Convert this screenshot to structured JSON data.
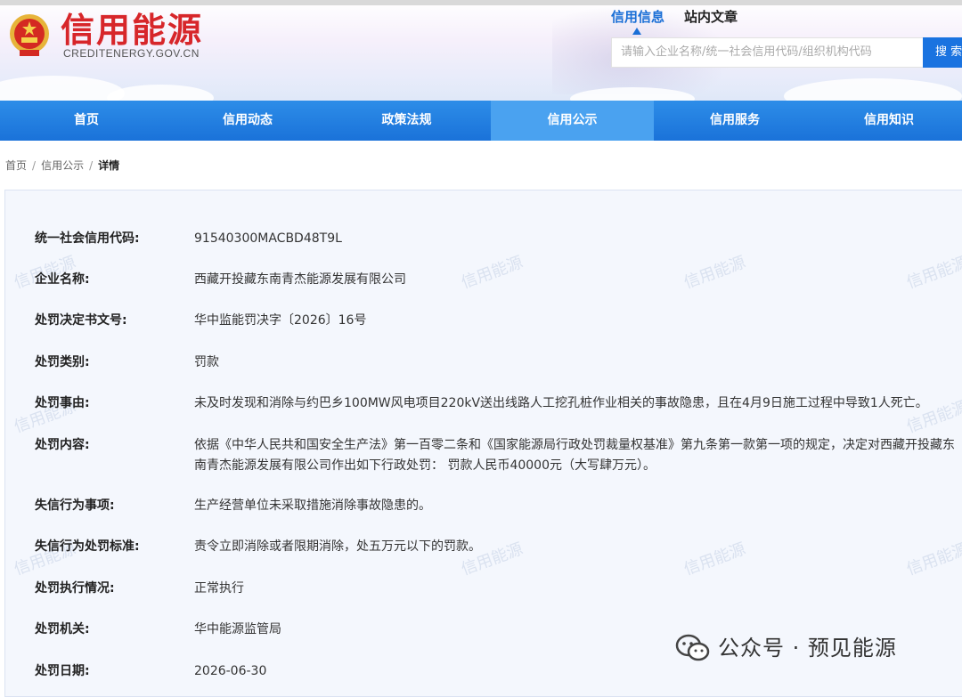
{
  "header": {
    "title": "信用能源",
    "subtitle": "CREDITENERGY.GOV.CN",
    "search_tabs": [
      {
        "label": "信用信息",
        "active": true
      },
      {
        "label": "站内文章",
        "active": false
      }
    ],
    "search_placeholder": "请输入企业名称/统一社会信用代码/组织机构代码",
    "search_button": "搜 索"
  },
  "nav": {
    "items": [
      {
        "label": "首页",
        "active": false
      },
      {
        "label": "信用动态",
        "active": false
      },
      {
        "label": "政策法规",
        "active": false
      },
      {
        "label": "信用公示",
        "active": true
      },
      {
        "label": "信用服务",
        "active": false
      },
      {
        "label": "信用知识",
        "active": false
      }
    ]
  },
  "breadcrumb": {
    "items": [
      "首页",
      "信用公示"
    ],
    "current": "详情",
    "separator": "/"
  },
  "watermark_text": "信用能源",
  "detail": {
    "rows": [
      {
        "label": "统一社会信用代码:",
        "value": "91540300MACBD48T9L"
      },
      {
        "label": "企业名称:",
        "value": "西藏开投藏东南青杰能源发展有限公司"
      },
      {
        "label": "处罚决定书文号:",
        "value": "华中监能罚决字〔2026〕16号"
      },
      {
        "label": "处罚类别:",
        "value": "罚款"
      },
      {
        "label": "处罚事由:",
        "value": "未及时发现和消除与约巴乡100MW风电项目220kV送出线路人工挖孔桩作业相关的事故隐患，且在4月9日施工过程中导致1人死亡。"
      },
      {
        "label": "处罚内容:",
        "value": "依据《中华人民共和国安全生产法》第一百零二条和《国家能源局行政处罚裁量权基准》第九条第一款第一项的规定，决定对西藏开投藏东南青杰能源发展有限公司作出如下行政处罚： 罚款人民币40000元（大写肆万元）。"
      },
      {
        "label": "失信行为事项:",
        "value": "生产经营单位未采取措施消除事故隐患的。"
      },
      {
        "label": "失信行为处罚标准:",
        "value": "责令立即消除或者限期消除，处五万元以下的罚款。"
      },
      {
        "label": "处罚执行情况:",
        "value": "正常执行"
      },
      {
        "label": "处罚机关:",
        "value": "华中能源监管局"
      },
      {
        "label": "处罚日期:",
        "value": "2026-06-30"
      }
    ]
  },
  "account_watermark": "公众号 · 预见能源",
  "colors": {
    "brand_red": "#d7262a",
    "nav_blue": "#1a72d9",
    "nav_active": "#4aa2f0",
    "accent_blue": "#1a6fd6"
  }
}
